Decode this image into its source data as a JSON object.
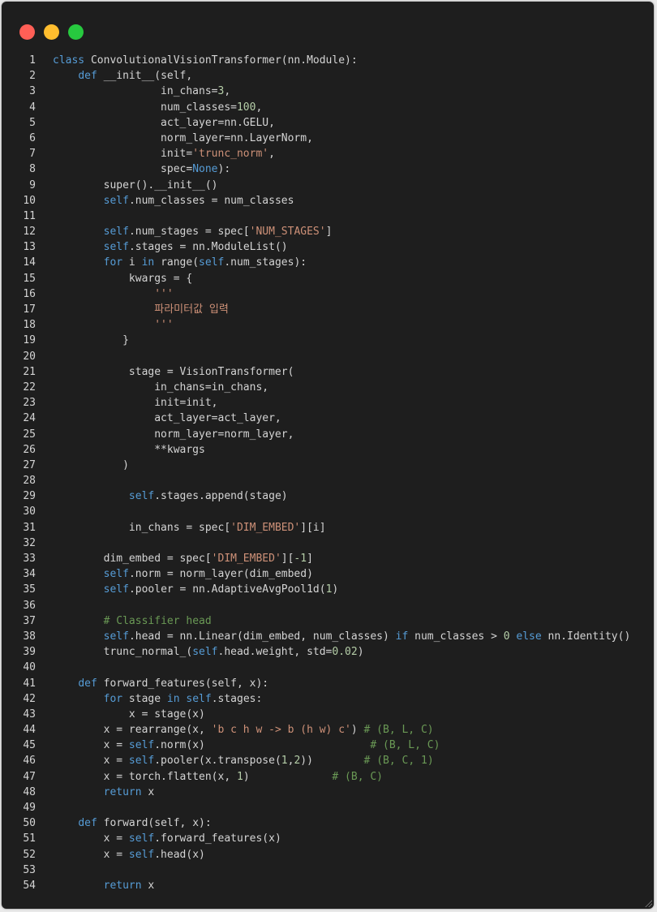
{
  "window": {
    "dots": [
      {
        "name": "close",
        "color": "#ff5f56"
      },
      {
        "name": "minimize",
        "color": "#ffbd2e"
      },
      {
        "name": "maximize",
        "color": "#27c93f"
      }
    ]
  },
  "code": {
    "lines": [
      [
        [
          "k",
          "class"
        ],
        [
          "p",
          " ConvolutionalVisionTransformer(nn.Module):"
        ]
      ],
      [
        [
          "p",
          "    "
        ],
        [
          "k",
          "def"
        ],
        [
          "p",
          " __init__(self,"
        ]
      ],
      [
        [
          "p",
          "                 in_chans="
        ],
        [
          "n",
          "3"
        ],
        [
          "p",
          ","
        ]
      ],
      [
        [
          "p",
          "                 num_classes="
        ],
        [
          "n",
          "100"
        ],
        [
          "p",
          ","
        ]
      ],
      [
        [
          "p",
          "                 act_layer=nn.GELU,"
        ]
      ],
      [
        [
          "p",
          "                 norm_layer=nn.LayerNorm,"
        ]
      ],
      [
        [
          "p",
          "                 init="
        ],
        [
          "s",
          "'trunc_norm'"
        ],
        [
          "p",
          ","
        ]
      ],
      [
        [
          "p",
          "                 spec="
        ],
        [
          "k",
          "None"
        ],
        [
          "p",
          "):"
        ]
      ],
      [
        [
          "p",
          "        super().__init__()"
        ]
      ],
      [
        [
          "p",
          "        "
        ],
        [
          "k",
          "self"
        ],
        [
          "p",
          ".num_classes = num_classes"
        ]
      ],
      [
        [
          "p",
          ""
        ]
      ],
      [
        [
          "p",
          "        "
        ],
        [
          "k",
          "self"
        ],
        [
          "p",
          ".num_stages = spec["
        ],
        [
          "s",
          "'NUM_STAGES'"
        ],
        [
          "p",
          "]"
        ]
      ],
      [
        [
          "p",
          "        "
        ],
        [
          "k",
          "self"
        ],
        [
          "p",
          ".stages = nn.ModuleList()"
        ]
      ],
      [
        [
          "p",
          "        "
        ],
        [
          "k",
          "for"
        ],
        [
          "p",
          " i "
        ],
        [
          "k",
          "in"
        ],
        [
          "p",
          " range("
        ],
        [
          "k",
          "self"
        ],
        [
          "p",
          ".num_stages):"
        ]
      ],
      [
        [
          "p",
          "            kwargs = {"
        ]
      ],
      [
        [
          "p",
          "                "
        ],
        [
          "s",
          "'''"
        ]
      ],
      [
        [
          "p",
          "                "
        ],
        [
          "s",
          "파라미터값 입력"
        ]
      ],
      [
        [
          "p",
          "                "
        ],
        [
          "s",
          "'''"
        ]
      ],
      [
        [
          "p",
          "           }"
        ]
      ],
      [
        [
          "p",
          ""
        ]
      ],
      [
        [
          "p",
          "            stage = VisionTransformer("
        ]
      ],
      [
        [
          "p",
          "                in_chans=in_chans,"
        ]
      ],
      [
        [
          "p",
          "                init=init,"
        ]
      ],
      [
        [
          "p",
          "                act_layer=act_layer,"
        ]
      ],
      [
        [
          "p",
          "                norm_layer=norm_layer,"
        ]
      ],
      [
        [
          "p",
          "                **kwargs"
        ]
      ],
      [
        [
          "p",
          "           )"
        ]
      ],
      [
        [
          "p",
          ""
        ]
      ],
      [
        [
          "p",
          "            "
        ],
        [
          "k",
          "self"
        ],
        [
          "p",
          ".stages.append(stage)"
        ]
      ],
      [
        [
          "p",
          ""
        ]
      ],
      [
        [
          "p",
          "            in_chans = spec["
        ],
        [
          "s",
          "'DIM_EMBED'"
        ],
        [
          "p",
          "][i]"
        ]
      ],
      [
        [
          "p",
          ""
        ]
      ],
      [
        [
          "p",
          "        dim_embed = spec["
        ],
        [
          "s",
          "'DIM_EMBED'"
        ],
        [
          "p",
          "]["
        ],
        [
          "n",
          "-1"
        ],
        [
          "p",
          "]"
        ]
      ],
      [
        [
          "p",
          "        "
        ],
        [
          "k",
          "self"
        ],
        [
          "p",
          ".norm = norm_layer(dim_embed)"
        ]
      ],
      [
        [
          "p",
          "        "
        ],
        [
          "k",
          "self"
        ],
        [
          "p",
          ".pooler = nn.AdaptiveAvgPool1d("
        ],
        [
          "n",
          "1"
        ],
        [
          "p",
          ")"
        ]
      ],
      [
        [
          "p",
          ""
        ]
      ],
      [
        [
          "p",
          "        "
        ],
        [
          "c",
          "# Classifier head"
        ]
      ],
      [
        [
          "p",
          "        "
        ],
        [
          "k",
          "self"
        ],
        [
          "p",
          ".head = nn.Linear(dim_embed, num_classes) "
        ],
        [
          "k",
          "if"
        ],
        [
          "p",
          " num_classes > "
        ],
        [
          "n",
          "0"
        ],
        [
          "p",
          " "
        ],
        [
          "k",
          "else"
        ],
        [
          "p",
          " nn.Identity()"
        ]
      ],
      [
        [
          "p",
          "        trunc_normal_("
        ],
        [
          "k",
          "self"
        ],
        [
          "p",
          ".head.weight, std="
        ],
        [
          "n",
          "0.02"
        ],
        [
          "p",
          ")"
        ]
      ],
      [
        [
          "p",
          ""
        ]
      ],
      [
        [
          "p",
          "    "
        ],
        [
          "k",
          "def"
        ],
        [
          "p",
          " forward_features(self, x):"
        ]
      ],
      [
        [
          "p",
          "        "
        ],
        [
          "k",
          "for"
        ],
        [
          "p",
          " stage "
        ],
        [
          "k",
          "in"
        ],
        [
          "p",
          " "
        ],
        [
          "k",
          "self"
        ],
        [
          "p",
          ".stages:"
        ]
      ],
      [
        [
          "p",
          "            x = stage(x)"
        ]
      ],
      [
        [
          "p",
          "        x = rearrange(x, "
        ],
        [
          "s",
          "'b c h w -> b (h w) c'"
        ],
        [
          "p",
          ") "
        ],
        [
          "c",
          "# (B, L, C)"
        ]
      ],
      [
        [
          "p",
          "        x = "
        ],
        [
          "k",
          "self"
        ],
        [
          "p",
          ".norm(x)                          "
        ],
        [
          "c",
          "# (B, L, C)"
        ]
      ],
      [
        [
          "p",
          "        x = "
        ],
        [
          "k",
          "self"
        ],
        [
          "p",
          ".pooler(x.transpose("
        ],
        [
          "n",
          "1"
        ],
        [
          "p",
          ","
        ],
        [
          "n",
          "2"
        ],
        [
          "p",
          "))        "
        ],
        [
          "c",
          "# (B, C, 1)"
        ]
      ],
      [
        [
          "p",
          "        x = torch.flatten(x, "
        ],
        [
          "n",
          "1"
        ],
        [
          "p",
          ")             "
        ],
        [
          "c",
          "# (B, C)"
        ]
      ],
      [
        [
          "p",
          "        "
        ],
        [
          "k",
          "return"
        ],
        [
          "p",
          " x"
        ]
      ],
      [
        [
          "p",
          ""
        ]
      ],
      [
        [
          "p",
          "    "
        ],
        [
          "k",
          "def"
        ],
        [
          "p",
          " forward(self, x):"
        ]
      ],
      [
        [
          "p",
          "        x = "
        ],
        [
          "k",
          "self"
        ],
        [
          "p",
          ".forward_features(x)"
        ]
      ],
      [
        [
          "p",
          "        x = "
        ],
        [
          "k",
          "self"
        ],
        [
          "p",
          ".head(x)"
        ]
      ],
      [
        [
          "p",
          ""
        ]
      ],
      [
        [
          "p",
          "        "
        ],
        [
          "k",
          "return"
        ],
        [
          "p",
          " x"
        ]
      ]
    ]
  }
}
